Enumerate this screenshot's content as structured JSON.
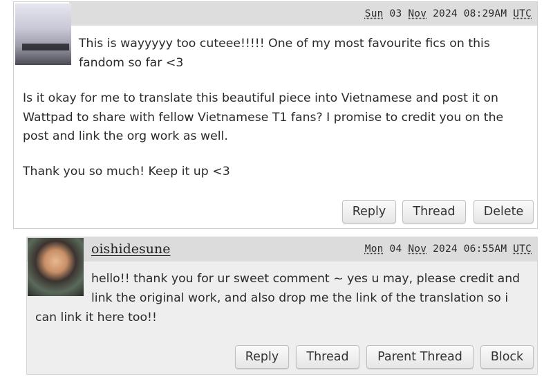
{
  "comments": [
    {
      "date": {
        "day": "Sun",
        "date": "03",
        "month": "Nov",
        "year": "2024",
        "time": "08:29AM",
        "tz": "UTC"
      },
      "paragraphs": [
        "This is wayyyyy too cuteee!!!!! One of my most favourite fics on this fandom so far <3",
        "Is it okay for me to translate this beautiful piece into Vietnamese and post it on Wattpad to share with fellow Vietnamese T1 fans? I promise to credit you on the post and link the org work as well.",
        "Thank you so much! Keep it up <3"
      ],
      "actions": [
        "Reply",
        "Thread",
        "Delete"
      ]
    },
    {
      "username": "oishidesune",
      "date": {
        "day": "Mon",
        "date": "04",
        "month": "Nov",
        "year": "2024",
        "time": "06:55AM",
        "tz": "UTC"
      },
      "paragraphs": [
        "hello!! thank you for ur sweet comment ~ yes u may, please credit and link the original work, and also drop me the link of the translation so i",
        "can link it here too!!"
      ],
      "actions": [
        "Reply",
        "Thread",
        "Parent Thread",
        "Block"
      ]
    }
  ]
}
